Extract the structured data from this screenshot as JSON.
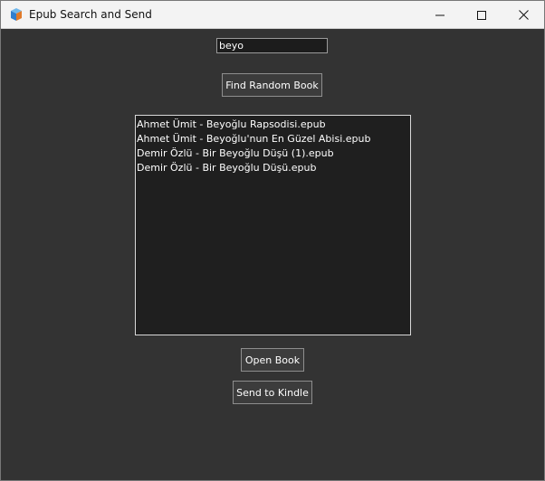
{
  "window": {
    "title": "Epub Search and Send",
    "icon": "book-app-icon",
    "controls": [
      "minimize-icon",
      "maximize-icon",
      "close-icon"
    ]
  },
  "search": {
    "value": "beyo"
  },
  "buttons": {
    "find_random": "Find Random Book",
    "open_book": "Open Book",
    "send_to_kindle": "Send to Kindle"
  },
  "results": {
    "items": [
      "Ahmet Ümit - Beyoğlu Rapsodisi.epub",
      "Ahmet Ümit - Beyoğlu'nun En Güzel Abisi.epub",
      "Demir Özlü - Bir Beyoğlu Düşü (1).epub",
      "Demir Özlü - Bir Beyoğlu Düşü.epub"
    ]
  },
  "colors": {
    "background": "#333333",
    "listbox_background": "#1f1f1f",
    "titlebar": "#f3f3f3",
    "text": "#ffffff"
  }
}
